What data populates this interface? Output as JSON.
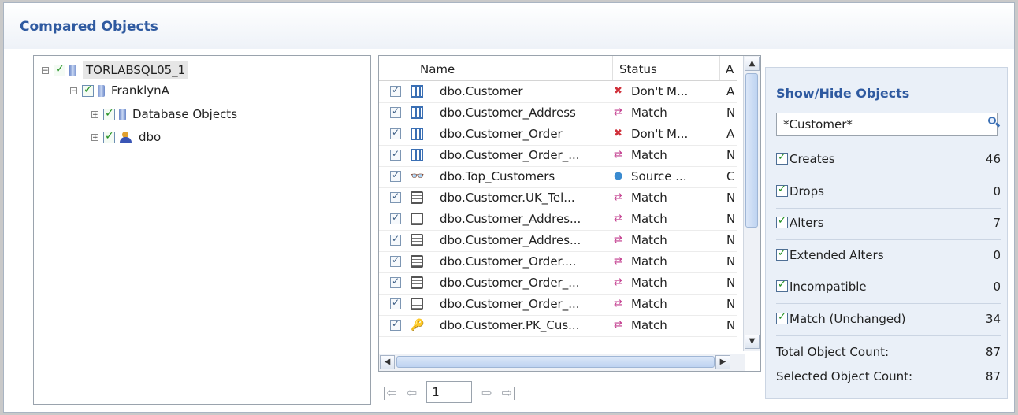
{
  "title": "Compared Objects",
  "tree": {
    "nodes": [
      {
        "label": "TORLABSQL05_1",
        "expander": "⊟",
        "icon": "database-icon"
      },
      {
        "label": "FranklynA",
        "expander": "⊟",
        "icon": "database-icon"
      },
      {
        "label": "Database Objects",
        "expander": "⊞",
        "icon": "database-icon"
      },
      {
        "label": "dbo",
        "expander": "⊞",
        "icon": "user-icon"
      }
    ]
  },
  "grid": {
    "headers": {
      "name": "Name",
      "status": "Status",
      "action": "A"
    },
    "rows": [
      {
        "name": "dbo.Customer",
        "status": "Don't M...",
        "action": "A",
        "type": "table",
        "status_icon": "don't-match"
      },
      {
        "name": "dbo.Customer_Address",
        "status": "Match",
        "action": "N",
        "type": "table",
        "status_icon": "match"
      },
      {
        "name": "dbo.Customer_Order",
        "status": "Don't M...",
        "action": "A",
        "type": "table",
        "status_icon": "don't-match"
      },
      {
        "name": "dbo.Customer_Order_...",
        "status": "Match",
        "action": "N",
        "type": "table",
        "status_icon": "match"
      },
      {
        "name": "dbo.Top_Customers",
        "status": "Source ...",
        "action": "C",
        "type": "view",
        "status_icon": "source-only"
      },
      {
        "name": "dbo.Customer.UK_Tel...",
        "status": "Match",
        "action": "N",
        "type": "index",
        "status_icon": "match"
      },
      {
        "name": "dbo.Customer_Addres...",
        "status": "Match",
        "action": "N",
        "type": "index",
        "status_icon": "match"
      },
      {
        "name": "dbo.Customer_Addres...",
        "status": "Match",
        "action": "N",
        "type": "index",
        "status_icon": "match"
      },
      {
        "name": "dbo.Customer_Order....",
        "status": "Match",
        "action": "N",
        "type": "index",
        "status_icon": "match"
      },
      {
        "name": "dbo.Customer_Order_...",
        "status": "Match",
        "action": "N",
        "type": "index",
        "status_icon": "match"
      },
      {
        "name": "dbo.Customer_Order_...",
        "status": "Match",
        "action": "N",
        "type": "index",
        "status_icon": "match"
      },
      {
        "name": "dbo.Customer.PK_Cus...",
        "status": "Match",
        "action": "N",
        "type": "key",
        "status_icon": "match"
      }
    ]
  },
  "pager": {
    "page": "1"
  },
  "show_hide": {
    "title": "Show/Hide Objects",
    "search_value": "*Customer*",
    "filters": [
      {
        "label": "Creates",
        "count": "46"
      },
      {
        "label": "Drops",
        "count": "0"
      },
      {
        "label": "Alters",
        "count": "7"
      },
      {
        "label": "Extended Alters",
        "count": "0"
      },
      {
        "label": "Incompatible",
        "count": "0"
      },
      {
        "label": "Match (Unchanged)",
        "count": "34"
      }
    ],
    "total_label": "Total Object Count:",
    "total_value": "87",
    "selected_label": "Selected Object Count:",
    "selected_value": "87"
  }
}
